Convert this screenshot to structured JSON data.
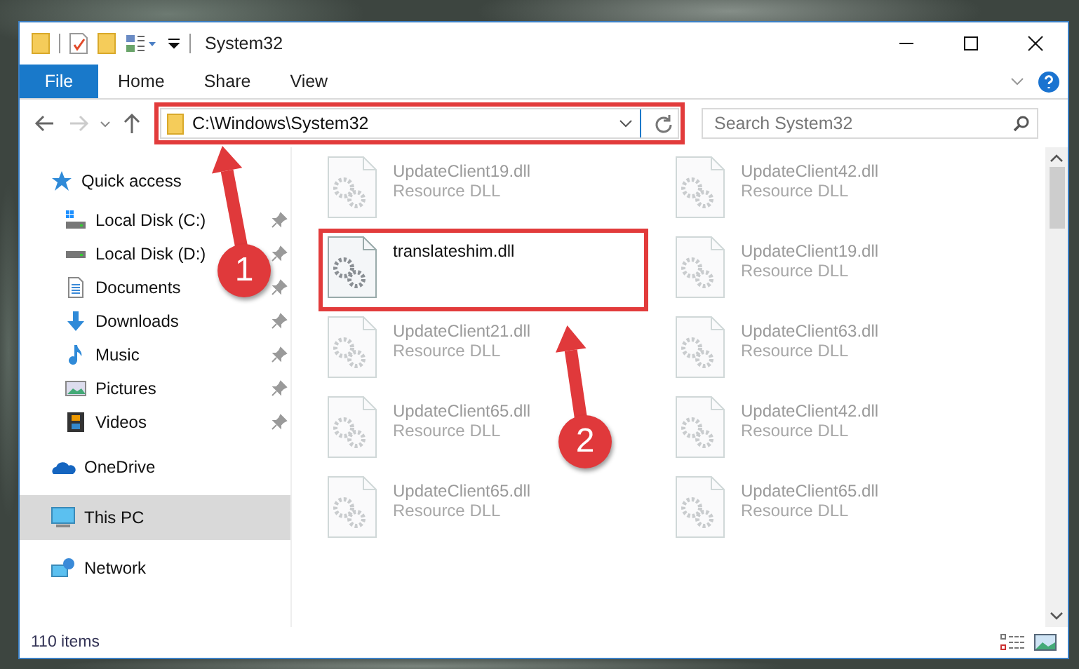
{
  "window": {
    "title": "System32"
  },
  "ribbon": {
    "file_tab": "File",
    "tabs": [
      "Home",
      "Share",
      "View"
    ]
  },
  "address": {
    "path": "C:\\Windows\\System32",
    "highlighted": true
  },
  "search": {
    "placeholder": "Search System32"
  },
  "sidebar": {
    "items": [
      {
        "label": "Quick access",
        "kind": "star",
        "selected": false,
        "children": [
          {
            "label": "Local Disk (C:)",
            "kind": "drive-c",
            "pinned": true,
            "selected": false
          },
          {
            "label": "Local Disk (D:)",
            "kind": "drive",
            "pinned": true,
            "selected": false
          },
          {
            "label": "Documents",
            "kind": "documents",
            "pinned": true,
            "selected": false
          },
          {
            "label": "Downloads",
            "kind": "downloads",
            "pinned": true,
            "selected": false
          },
          {
            "label": "Music",
            "kind": "music",
            "pinned": true,
            "selected": false
          },
          {
            "label": "Pictures",
            "kind": "pictures",
            "pinned": true,
            "selected": false
          },
          {
            "label": "Videos",
            "kind": "videos",
            "pinned": true,
            "selected": false
          }
        ]
      },
      {
        "label": "OneDrive",
        "kind": "cloud",
        "selected": false
      },
      {
        "label": "This PC",
        "kind": "pc",
        "selected": true
      },
      {
        "label": "Network",
        "kind": "network",
        "selected": false
      }
    ]
  },
  "files": [
    {
      "name": "UpdateClient19.dll",
      "type": "Resource DLL",
      "highlighted": false
    },
    {
      "name": "UpdateClient42.dll",
      "type": "Resource DLL",
      "highlighted": false
    },
    {
      "name": "translateshim.dll",
      "highlighted": true
    },
    {
      "name": "UpdateClient19.dll",
      "type": "Resource DLL",
      "highlighted": false
    },
    {
      "name": "UpdateClient21.dll",
      "type": "Resource DLL",
      "highlighted": false
    },
    {
      "name": "UpdateClient63.dll",
      "type": "Resource DLL",
      "highlighted": false
    },
    {
      "name": "UpdateClient65.dll",
      "type": "Resource DLL",
      "highlighted": false
    },
    {
      "name": "UpdateClient42.dll",
      "type": "Resource DLL",
      "highlighted": false
    },
    {
      "name": "UpdateClient65.dll",
      "type": "Resource DLL",
      "highlighted": false
    },
    {
      "name": "UpdateClient65.dll",
      "type": "Resource DLL",
      "highlighted": false
    }
  ],
  "status_bar": {
    "count": "110 items"
  },
  "annotations": [
    {
      "number": "1"
    },
    {
      "number": "2"
    }
  ]
}
